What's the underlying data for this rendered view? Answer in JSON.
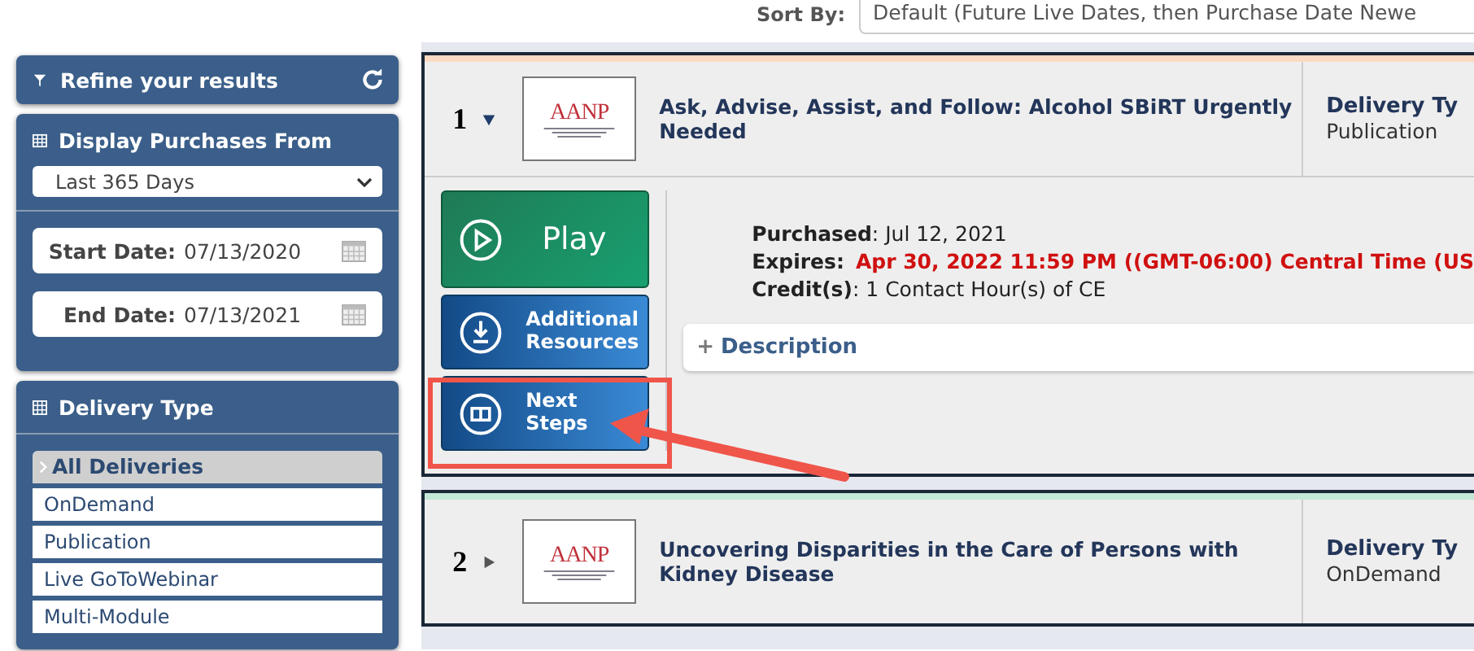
{
  "sort": {
    "label": "Sort By:",
    "value": "Default (Future Live Dates, then Purchase Date Newe"
  },
  "sidebar": {
    "refine": {
      "title": "Refine your results"
    },
    "display_from": {
      "title": "Display Purchases From",
      "range": "Last 365 Days",
      "start": {
        "label": "Start Date:",
        "value": "07/13/2020"
      },
      "end": {
        "label": "End Date:",
        "value": "07/13/2021"
      }
    },
    "delivery_type": {
      "title": "Delivery Type",
      "items": [
        {
          "label": "All Deliveries",
          "selected": true
        },
        {
          "label": "OnDemand",
          "selected": false
        },
        {
          "label": "Publication",
          "selected": false
        },
        {
          "label": "Live GoToWebinar",
          "selected": false
        },
        {
          "label": "Multi-Module",
          "selected": false
        }
      ]
    }
  },
  "results": [
    {
      "number": "1",
      "expanded": true,
      "color": "#fcd9c3",
      "logo": "AANP",
      "title": "Ask, Advise, Assist, and Follow: Alcohol SBiRT Urgently Needed",
      "type_label": "Delivery Ty",
      "type": "Publication",
      "actions": [
        {
          "kind": "play",
          "label": "Play"
        },
        {
          "kind": "download",
          "label": "Additional Resources"
        },
        {
          "kind": "steps",
          "label": "Next Steps"
        }
      ],
      "purchased": "**Purchased**: Jul 12, 2021",
      "expires_label": "Expires:",
      "expires": "Apr 30, 2022 11:59 PM ((GMT-06:00) Central Time (US",
      "credits": "**Credit(s)**: 1 Contact Hour(s) of CE",
      "description_sign": "+",
      "description": "Description"
    },
    {
      "number": "2",
      "expanded": false,
      "color": "#c3e8d8",
      "logo": "AANP",
      "title": "Uncovering Disparities in the Care of Persons with Kidney Disease",
      "type_label": "Delivery Ty",
      "type": "OnDemand"
    }
  ]
}
